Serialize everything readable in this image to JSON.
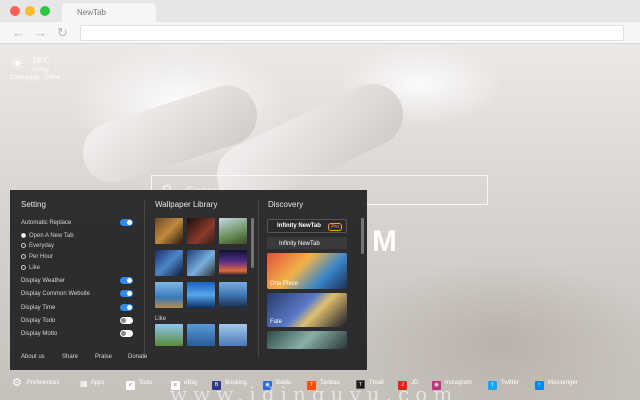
{
  "browser": {
    "tab_title": "NewTab",
    "back_icon": "arrow-left-icon",
    "forward_icon": "arrow-right-icon",
    "reload_icon": "reload-icon"
  },
  "weather": {
    "temperature": "18°C",
    "condition": "Sunny",
    "location": "Chongqing · China",
    "icon": "sun-icon"
  },
  "search": {
    "placeholder": "Search"
  },
  "logo_fragment": "M",
  "panel": {
    "setting_title": "Setting",
    "auto_replace_label": "Automatic Replace",
    "auto_replace_on": true,
    "replace_options": [
      {
        "label": "Open A New Tab",
        "selected": true
      },
      {
        "label": "Everyday",
        "selected": false
      },
      {
        "label": "Per Hour",
        "selected": false
      },
      {
        "label": "Like",
        "selected": false
      }
    ],
    "toggles": [
      {
        "label": "Display Weather",
        "on": true
      },
      {
        "label": "Display Common Website",
        "on": true
      },
      {
        "label": "Display Time",
        "on": true
      },
      {
        "label": "Display Todo",
        "on": false
      },
      {
        "label": "Display Motto",
        "on": false
      }
    ],
    "wallpaper_title": "Wallpaper Library",
    "like_label": "Like",
    "discovery_title": "Discovery",
    "discovery_cards": [
      {
        "label": "Infinity NewTab",
        "badge": "Pro"
      },
      {
        "label": "Infinity NewTab"
      },
      {
        "label": "One Piece"
      },
      {
        "label": "Fate"
      }
    ],
    "footer_links": [
      "About us",
      "Share",
      "Praise",
      "Donate"
    ]
  },
  "dock": {
    "preferences_label": "Preferences",
    "apps_label": "Apps",
    "items": [
      {
        "label": "Todo",
        "color": "#ffffff",
        "icon": "check-icon"
      },
      {
        "label": "eBay",
        "color": "#ffffff",
        "icon": "ebay-icon"
      },
      {
        "label": "Booking",
        "color": "#2a3a8c",
        "icon": "booking-icon"
      },
      {
        "label": "Baidu",
        "color": "#2d6bd9",
        "icon": "baidu-icon"
      },
      {
        "label": "Taobao",
        "color": "#ff5000",
        "icon": "taobao-icon"
      },
      {
        "label": "Tmall",
        "color": "#1c1c1c",
        "icon": "tmall-icon"
      },
      {
        "label": "JD",
        "color": "#e1251b",
        "icon": "jd-icon"
      },
      {
        "label": "Instagram",
        "color": "#c13584",
        "icon": "instagram-icon"
      },
      {
        "label": "Twitter",
        "color": "#1da1f2",
        "icon": "twitter-icon"
      },
      {
        "label": "Messenger",
        "color": "#0084ff",
        "icon": "messenger-icon"
      }
    ]
  },
  "watermark": "www.idinguyu.com"
}
